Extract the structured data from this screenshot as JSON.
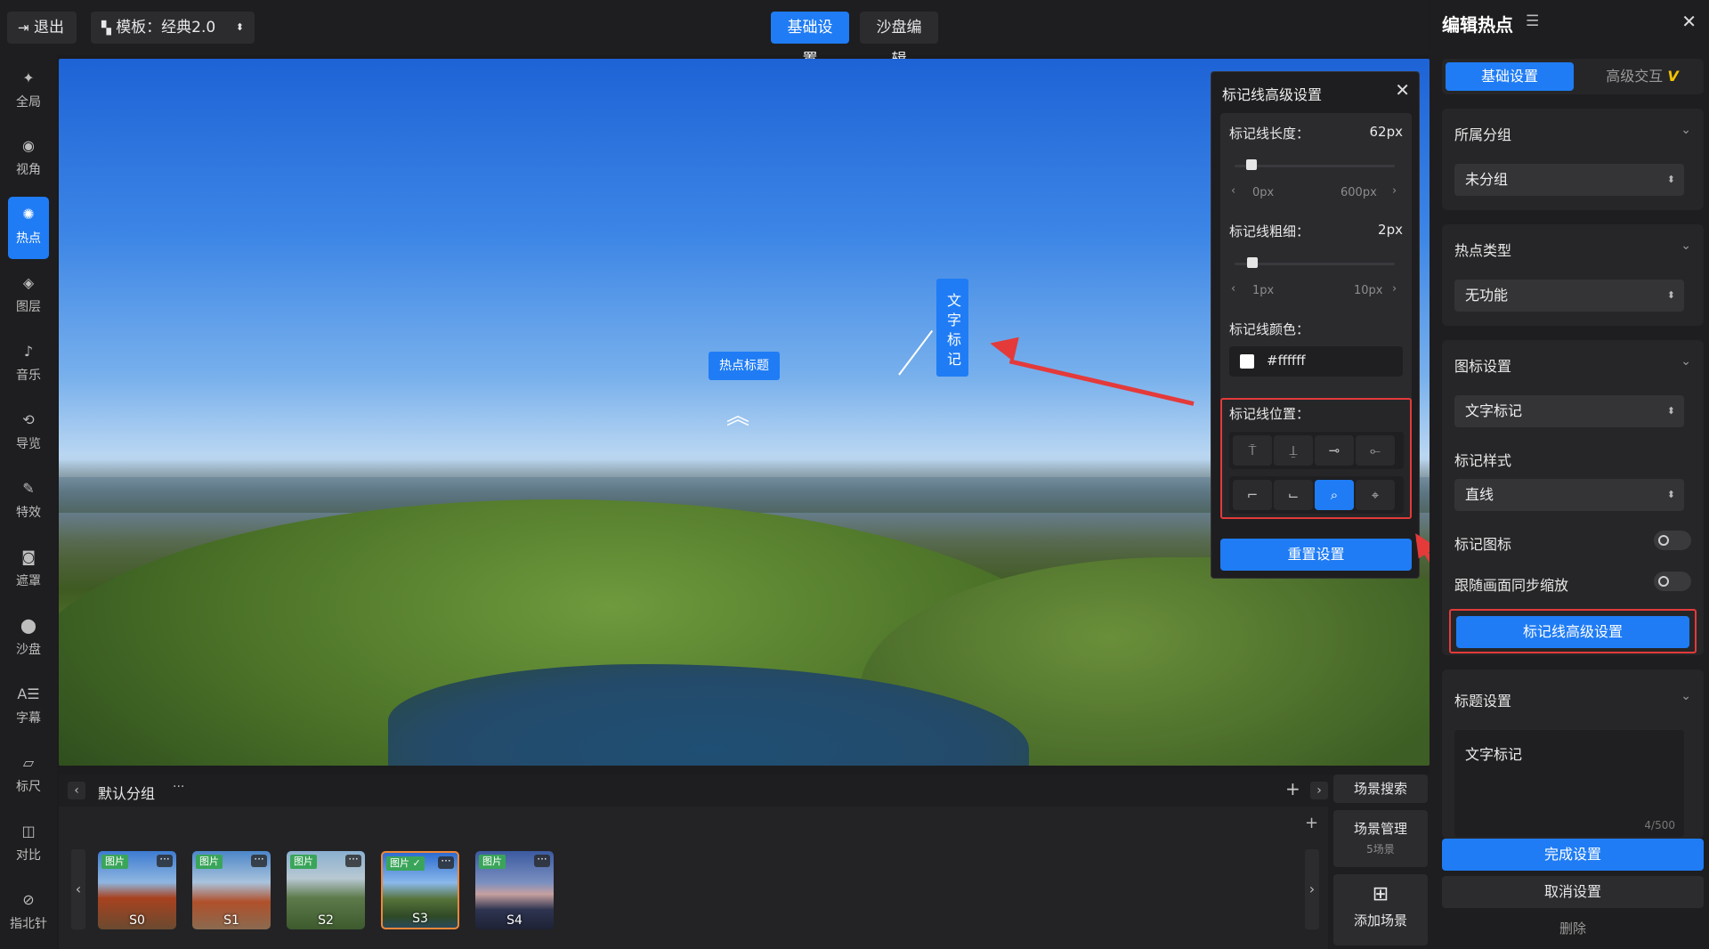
{
  "topbar": {
    "exit_label": "退出",
    "template_label": "模板：经典2.0",
    "tabs": [
      {
        "label": "基础设置",
        "active": true
      },
      {
        "label": "沙盘编辑",
        "active": false
      }
    ]
  },
  "left_nav": [
    {
      "label": "全局",
      "icon": "global-icon",
      "active": false
    },
    {
      "label": "视角",
      "icon": "eye-icon",
      "active": false
    },
    {
      "label": "热点",
      "icon": "hotspot-icon",
      "active": true
    },
    {
      "label": "图层",
      "icon": "layers-icon",
      "active": false
    },
    {
      "label": "音乐",
      "icon": "music-icon",
      "active": false
    },
    {
      "label": "导览",
      "icon": "tour-icon",
      "active": false
    },
    {
      "label": "特效",
      "icon": "effects-icon",
      "active": false
    },
    {
      "label": "遮罩",
      "icon": "mask-icon",
      "active": false
    },
    {
      "label": "沙盘",
      "icon": "location-pin-icon",
      "active": false
    },
    {
      "label": "字幕",
      "icon": "subtitle-icon",
      "active": false
    },
    {
      "label": "标尺",
      "icon": "ruler-icon",
      "active": false
    },
    {
      "label": "对比",
      "icon": "compare-icon",
      "active": false
    },
    {
      "label": "指北针",
      "icon": "compass-icon",
      "active": false
    }
  ],
  "viewport": {
    "hotspot_title": "热点标题",
    "text_marker": "文字标记"
  },
  "advanced_panel": {
    "title": "标记线高级设置",
    "length_label": "标记线长度：",
    "length_value": "62px",
    "length_min": "0px",
    "length_max": "600px",
    "length_fraction": 0.103,
    "thickness_label": "标记线粗细：",
    "thickness_value": "2px",
    "thickness_min": "1px",
    "thickness_max": "10px",
    "thickness_fraction": 0.111,
    "color_label": "标记线颜色：",
    "color_value": "#ffffff",
    "position_label": "标记线位置：",
    "position_selected_index": 6,
    "reset_label": "重置设置"
  },
  "right_panel": {
    "title": "编辑热点",
    "tabs": [
      {
        "label": "基础设置",
        "active": true
      },
      {
        "label": "高级交互",
        "active": false,
        "badge": "V"
      }
    ],
    "group_section": {
      "title": "所属分组",
      "value": "未分组"
    },
    "type_section": {
      "title": "热点类型",
      "value": "无功能"
    },
    "icon_section": {
      "title": "图标设置",
      "value": "文字标记",
      "style_label": "标记样式",
      "style_value": "直线",
      "marker_icon_label": "标记图标",
      "sync_zoom_label": "跟随画面同步缩放",
      "advanced_button": "标记线高级设置"
    },
    "title_section": {
      "title": "标题设置",
      "text": "文字标记",
      "counter": "4/500"
    },
    "done_label": "完成设置",
    "cancel_label": "取消设置",
    "delete_label": "删除"
  },
  "bottom": {
    "group_name": "默认分组",
    "scene_search": "场景搜索",
    "scene_manage": "场景管理",
    "scene_count": "5场景",
    "add_scene": "添加场景",
    "scenes": [
      {
        "name": "S0",
        "tag": "图片",
        "selected": false
      },
      {
        "name": "S1",
        "tag": "图片",
        "selected": false
      },
      {
        "name": "S2",
        "tag": "图片",
        "selected": false
      },
      {
        "name": "S3",
        "tag": "图片",
        "selected": true
      },
      {
        "name": "S4",
        "tag": "图片",
        "selected": false
      }
    ]
  },
  "colors": {
    "accent": "#1f7cf5",
    "highlight": "#e43a3a",
    "panel": "#1e1e20"
  }
}
